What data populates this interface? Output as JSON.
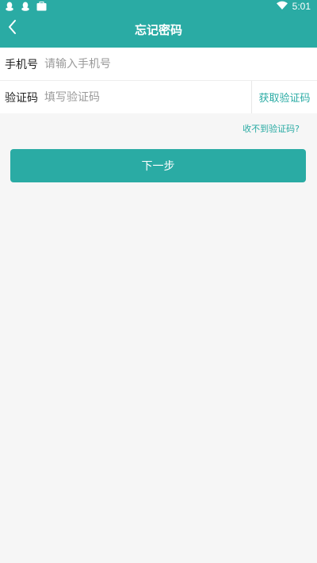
{
  "status_bar": {
    "time": "5:01",
    "left_icons": [
      "qq-icon",
      "qq-icon",
      "briefcase-icon"
    ],
    "right_icons": [
      "wifi-icon"
    ]
  },
  "header": {
    "title": "忘记密码",
    "back_icon": "chevron-left-icon"
  },
  "form": {
    "phone": {
      "label": "手机号",
      "placeholder": "请输入手机号",
      "value": ""
    },
    "code": {
      "label": "验证码",
      "placeholder": "填写验证码",
      "value": "",
      "get_code_label": "获取验证码"
    }
  },
  "no_code_link": "收不到验证码?",
  "next_button": "下一步",
  "colors": {
    "accent": "#2aaba4",
    "background": "#f6f6f6"
  }
}
